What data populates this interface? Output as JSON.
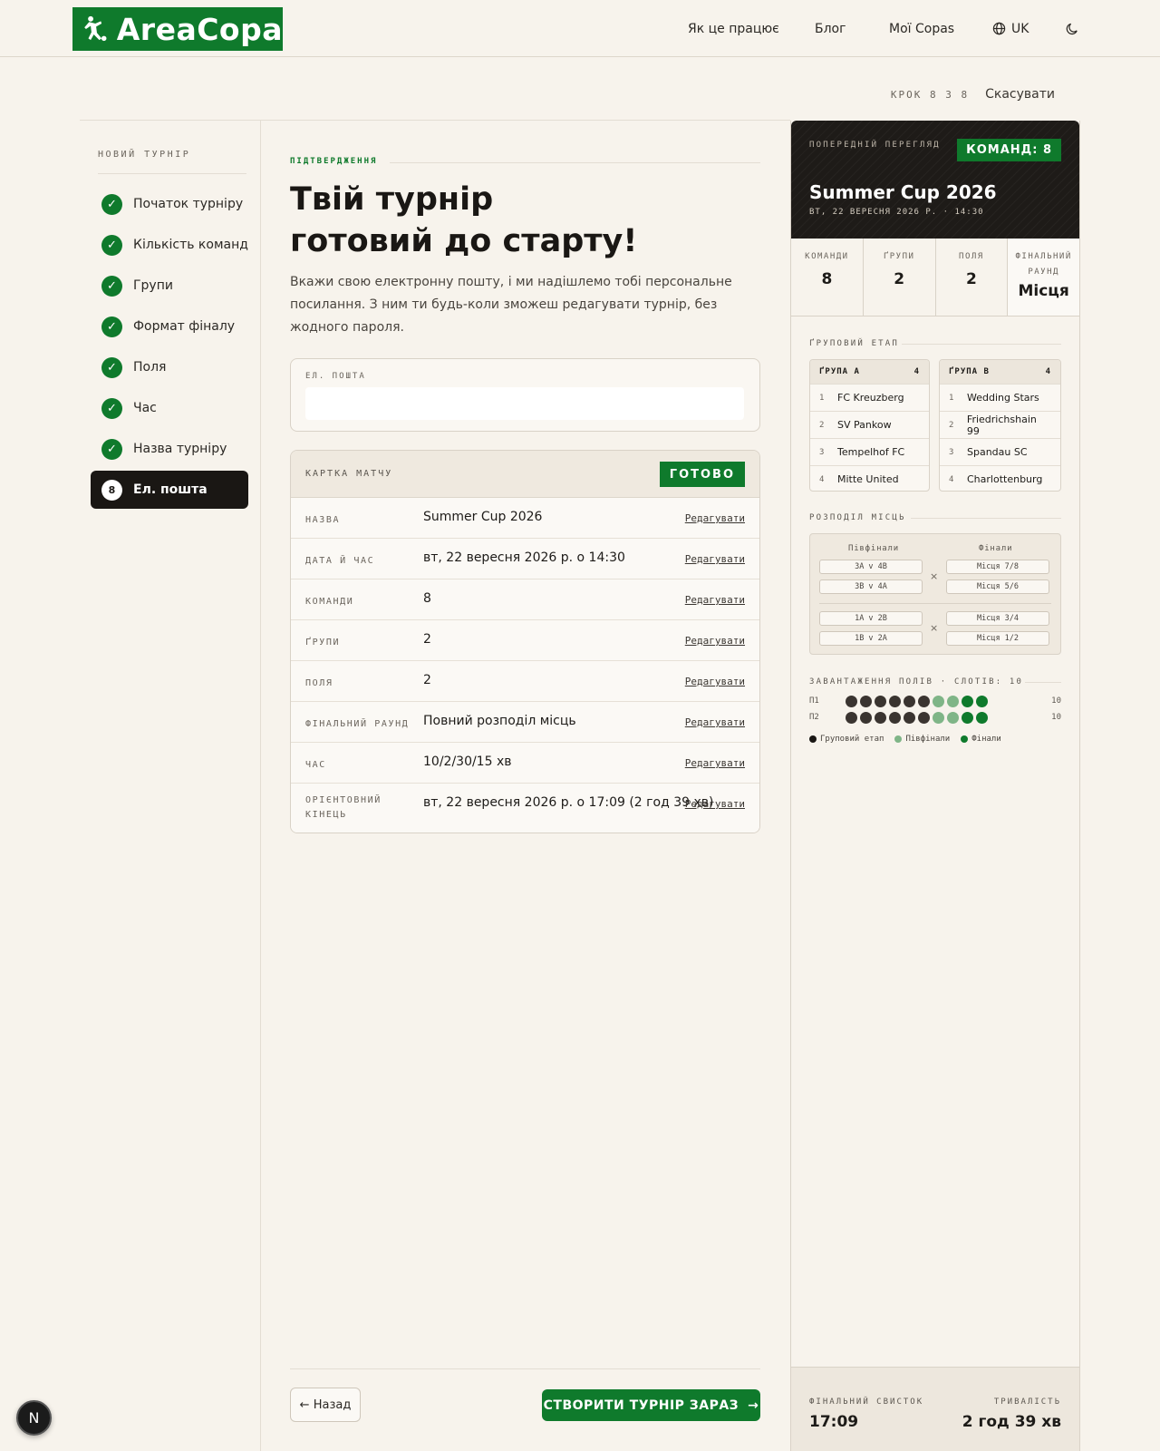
{
  "header": {
    "logo_text": "AreaCopa",
    "nav": [
      "Як це працює",
      "Блог",
      "Мої Copas"
    ],
    "lang": "UK"
  },
  "stepbar": {
    "step_text": "КРОК 8 З 8",
    "cancel": "Скасувати"
  },
  "sidebar": {
    "title": "НОВИЙ ТУРНІР",
    "steps": [
      "Початок турніру",
      "Кількість команд",
      "Групи",
      "Формат фіналу",
      "Поля",
      "Час",
      "Назва турніру"
    ],
    "active_num": "8",
    "active_label": "Ел. пошта"
  },
  "main": {
    "eyebrow": "ПІДТВЕРДЖЕННЯ",
    "title_line1": "Твій турнір",
    "title_line2": "готовий до старту!",
    "lead": "Вкажи свою електронну пошту, і ми надішлемо тобі персональне посилання. З ним ти будь-коли зможеш редагувати турнір, без жодного пароля.",
    "email_label": "ЕЛ. ПОШТА",
    "email_value": ""
  },
  "card": {
    "title": "КАРТКА МАТЧУ",
    "badge": "ГОТОВО",
    "edit": "Редагувати",
    "rows": [
      {
        "label": "НАЗВА",
        "value": "Summer Cup 2026"
      },
      {
        "label": "ДАТА Й ЧАС",
        "value": "вт, 22 вересня 2026 р. о 14:30"
      },
      {
        "label": "КОМАНДИ",
        "value": "8"
      },
      {
        "label": "ҐРУПИ",
        "value": "2"
      },
      {
        "label": "ПОЛЯ",
        "value": "2"
      },
      {
        "label": "ФІНАЛЬНИЙ РАУНД",
        "value": "Повний розподіл місць"
      },
      {
        "label": "ЧАС",
        "value": "10/2/30/15 хв"
      },
      {
        "label": "ОРІЄНТОВНИЙ КІНЕЦЬ",
        "value": "вт, 22 вересня 2026 р. о 17:09 (2 год 39 хв)"
      }
    ]
  },
  "buttons": {
    "back": "← Назад",
    "create": "СТВОРИТИ ТУРНІР ЗАРАЗ",
    "create_arrow": "→"
  },
  "preview": {
    "eyebrow": "ПОПЕРЕДНІЙ ПЕРЕГЛЯД",
    "badge": "КОМАНД: 8",
    "title": "Summer Cup 2026",
    "date": "ВТ, 22 ВЕРЕСНЯ 2026 Р. · 14:30",
    "stats": [
      {
        "label": "КОМАНДИ",
        "value": "8"
      },
      {
        "label": "ҐРУПИ",
        "value": "2"
      },
      {
        "label": "ПОЛЯ",
        "value": "2"
      },
      {
        "label": "ФІНАЛЬНИЙ РАУНД",
        "value": "Місця"
      }
    ],
    "group_stage": "ҐРУПОВИЙ ЕТАП",
    "groups": [
      {
        "name": "ҐРУПА А",
        "count": "4",
        "teams": [
          "FC Kreuzberg",
          "SV Pankow",
          "Tempelhof FC",
          "Mitte United"
        ]
      },
      {
        "name": "ҐРУПА В",
        "count": "4",
        "teams": [
          "Wedding Stars",
          "Friedrichshain 99",
          "Spandau SC",
          "Charlottenburg"
        ]
      }
    ],
    "distribution": "РОЗПОДІЛ МІСЦЬ",
    "semis_label": "Півфінали",
    "finals_label": "Фінали",
    "semis": [
      "3А v 4В",
      "3В v 4А",
      "1А v 2В",
      "1В v 2А"
    ],
    "finals": [
      "Місця 7/8",
      "Місця 5/6",
      "Місця 3/4",
      "Місця 1/2"
    ],
    "load_title": "ЗАВАНТАЖЕННЯ ПОЛІВ · СЛОТІВ: 10",
    "fields": [
      {
        "label": "П1",
        "count": "10",
        "slots": [
          "g",
          "g",
          "g",
          "g",
          "g",
          "g",
          "s",
          "s",
          "f",
          "f"
        ]
      },
      {
        "label": "П2",
        "count": "10",
        "slots": [
          "g",
          "g",
          "g",
          "g",
          "g",
          "g",
          "s",
          "s",
          "f",
          "f"
        ]
      }
    ],
    "legend": [
      "Груповий етап",
      "Півфінали",
      "Фінали"
    ],
    "colors": {
      "group": "#3a3430",
      "semi": "#7fb587",
      "final": "#0f7a2c",
      "accent": "#0f7a2c"
    },
    "foot_left_label": "ФІНАЛЬНИЙ СВИСТОК",
    "foot_left_value": "17:09",
    "foot_right_label": "ТРИВАЛІСТЬ",
    "foot_right_value": "2 год 39 хв"
  },
  "dev_badge": "N"
}
